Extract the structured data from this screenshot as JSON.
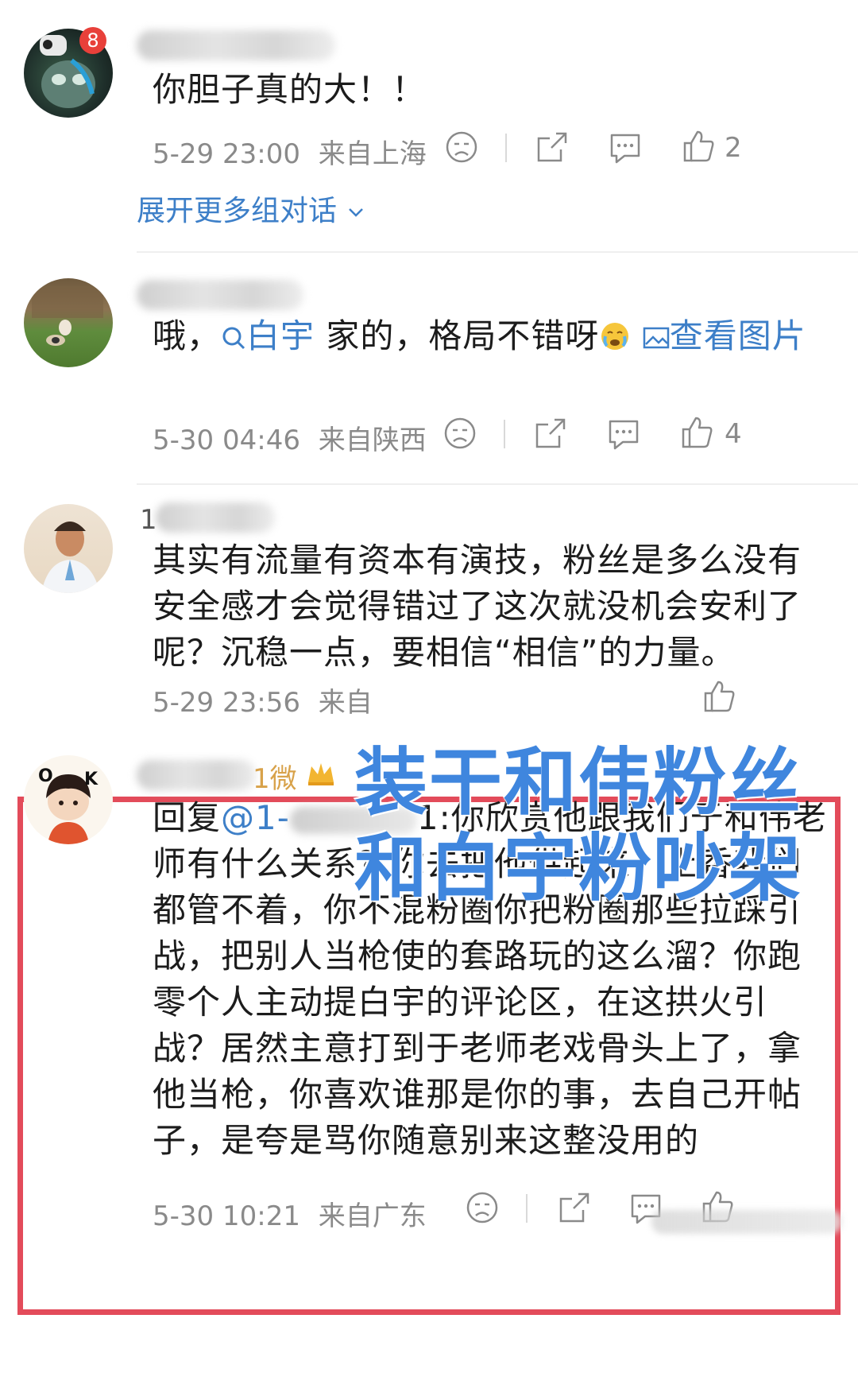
{
  "comments": [
    {
      "text": "你胆子真的大！！",
      "time": "5-29 23:00",
      "location": "来自上海",
      "likes": "2",
      "badge": "8",
      "expand": "展开更多组对话"
    },
    {
      "text_pre": "哦，",
      "topic_link": "白宇",
      "text_mid": " 家的，格局不错呀",
      "image_link": "查看图片",
      "time": "5-30 04:46",
      "location": "来自陕西",
      "likes": "4"
    },
    {
      "name_prefix": "1",
      "text": "其实有流量有资本有演技，粉丝是多么没有安全感才会觉得错过了这次就没机会安利了呢？沉稳一点，要相信“相信”的力量。",
      "time": "5-29 23:56",
      "location": "来自"
    },
    {
      "name_suffix": "1微",
      "reply_prefix": "回复",
      "reply_mention": "@1-",
      "reply_text_tail": "1:你欣赏他跟我们于和伟老师有什么关系？你去把他供起来，上香我们都管不着，你不混粉圈你把粉圈那些拉踩引战，把别人当枪使的套路玩的这么溜？你跑零个人主动提白宇的评论区，在这拱火引战？居然主意打到于老师老戏骨头上了，拿他当枪，你喜欢谁那是你的事，去自己开帖子，是夸是骂你随意别来这整没用的",
      "time": "5-30 10:21",
      "location": "来自广东"
    }
  ],
  "overlay": {
    "line1": "装干和伟粉丝",
    "line2": "和白宇粉吵架"
  },
  "avatar4_letters": [
    "O",
    "K"
  ],
  "colors": {
    "link": "#3d7fc8",
    "overlay_text": "#3f86de",
    "highlight_box": "#e34b5a",
    "meta_gray": "#8a8a8a"
  },
  "icons": [
    "dislike-icon",
    "share-icon",
    "comment-icon",
    "like-icon",
    "chevron-down-icon",
    "search-icon",
    "image-icon",
    "crying-emoji-icon",
    "crown-icon"
  ]
}
